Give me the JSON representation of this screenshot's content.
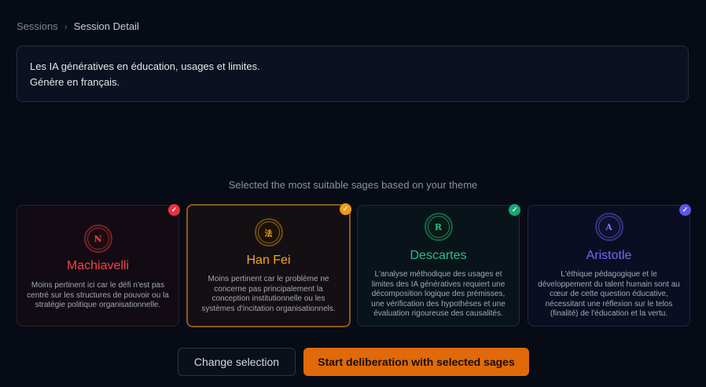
{
  "breadcrumb": {
    "parent": "Sessions",
    "separator": "›",
    "current": "Session Detail"
  },
  "prompt": {
    "line1": "Les IA génératives en éducation, usages et limites.",
    "line2": "Génère en français."
  },
  "subtitle": "Selected the most suitable sages based on your theme",
  "sages": [
    {
      "name": "Machiavelli",
      "initial": "N",
      "description": "Moins pertinent ici car le défi n'est pas centré sur les structures de pouvoir ou la stratégie politique organisationnelle.",
      "color": "#f0454a",
      "selected": true
    },
    {
      "name": "Han Fei",
      "initial": "法",
      "description": "Moins pertinent car le problème ne concerne pas principalement la conception institutionnelle ou les systèmes d'incitation organisationnels.",
      "color": "#f5a524",
      "selected": true
    },
    {
      "name": "Descartes",
      "initial": "R",
      "description": "L'analyse méthodique des usages et limites des IA génératives requiert une décomposition logique des prémisses, une vérification des hypothèses et une évaluation rigoureuse des causalités.",
      "color": "#22c08a",
      "selected": true
    },
    {
      "name": "Aristotle",
      "initial": "A",
      "description": "L'éthique pédagogique et le développement du talent humain sont au cœur de cette question éducative, nécessitant une réflexion sur le telos (finalité) de l'éducation et la vertu.",
      "color": "#6f6cf5",
      "selected": true
    }
  ],
  "check_glyph": "✓",
  "actions": {
    "change_label": "Change selection",
    "start_label": "Start deliberation with selected sages"
  }
}
